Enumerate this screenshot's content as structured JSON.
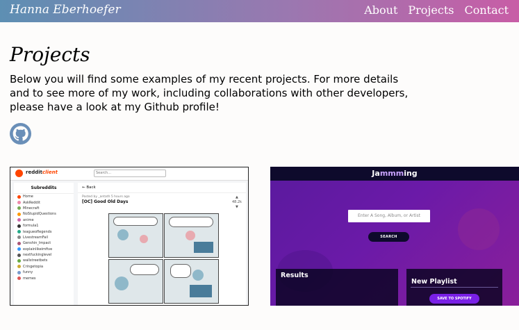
{
  "nav": {
    "brand": "Hanna Eberhoefer",
    "links": [
      "About",
      "Projects",
      "Contact"
    ]
  },
  "page": {
    "title": "Projects",
    "intro": "Below you will find some examples of my recent projects. For more details and to see more of my work, including collaborations with other developers, please have a look at my Github profile!",
    "github_icon": "github-icon"
  },
  "projects": [
    {
      "name": "reddit client",
      "brand_prefix": "reddit",
      "brand_suffix": "client",
      "search_placeholder": "Search...",
      "sidebar_title": "Subreddits",
      "subreddits": [
        "Home",
        "AskReddit",
        "Minecraft",
        "NoStupidQuestions",
        "anime",
        "formula1",
        "leagueoflegends",
        "LivestreamFail",
        "Genshin_Impact",
        "explainlikeimfive",
        "nextfuckinglevel",
        "wallstreetbets",
        "Cringetopia",
        "funny",
        "memes"
      ],
      "back_label": "Back",
      "posted_by": "Posted by _antath 5 hours ago",
      "post_title": "[OC] Good Old Days",
      "score": "48.2k",
      "colors": {
        "accent": "#ff4500"
      }
    },
    {
      "name": "Jammming",
      "logo_a": "Ja",
      "logo_b": "mmm",
      "logo_c": "ing",
      "search_placeholder": "Enter A Song, Album, or Artist",
      "search_button": "SEARCH",
      "results_title": "Results",
      "playlist_title": "New Playlist",
      "save_button": "SAVE TO SPOTIFY",
      "colors": {
        "background": "#6b1aa8",
        "button": "#7a20e6",
        "dark": "#0e0a2c"
      }
    }
  ]
}
